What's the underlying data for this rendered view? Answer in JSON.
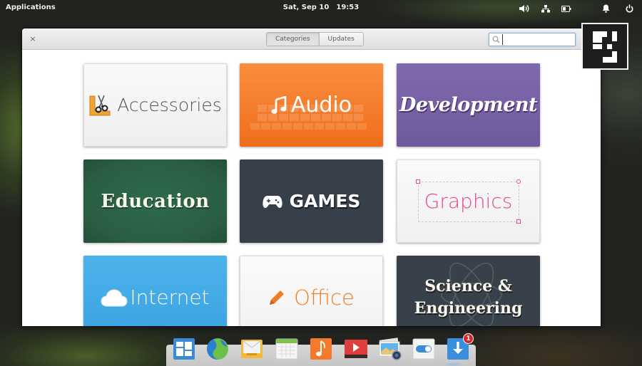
{
  "panel": {
    "applications_label": "Applications",
    "date": "Sat, Sep 10",
    "time": "19:53",
    "tray_icons": [
      "volume-icon",
      "network-icon",
      "battery-icon",
      "notifications-icon",
      "power-icon"
    ]
  },
  "window": {
    "close_glyph": "×",
    "view_switcher": [
      {
        "label": "Categories",
        "active": true
      },
      {
        "label": "Updates",
        "active": false
      }
    ],
    "search": {
      "value": "",
      "placeholder": ""
    },
    "maximize_icon": "maximize-icon"
  },
  "categories": [
    {
      "label": "Accessories",
      "icon": "accessories-icon",
      "color": "#555555"
    },
    {
      "label": "Audio",
      "icon": "music-note-icon",
      "color": "#f27a2a"
    },
    {
      "label": "Development",
      "icon": "",
      "color": "#7763a4"
    },
    {
      "label": "Education",
      "icon": "",
      "color": "#2a5e43"
    },
    {
      "label": "GAMES",
      "icon": "gamepad-icon",
      "color": "#37404a"
    },
    {
      "label": "Graphics",
      "icon": "",
      "color": "#e6478e"
    },
    {
      "label": "Internet",
      "icon": "cloud-icon",
      "color": "#3ea8e5"
    },
    {
      "label": "Office",
      "icon": "pencil-icon",
      "color": "#f07d21"
    },
    {
      "label": "Science &",
      "label2": "Engineering",
      "icon": "atom-icon",
      "color": "#38414a"
    }
  ],
  "dock": {
    "items": [
      {
        "name": "multitasking-view",
        "icon": "multitasking-icon"
      },
      {
        "name": "web-browser",
        "icon": "globe-icon"
      },
      {
        "name": "mail",
        "icon": "mail-icon"
      },
      {
        "name": "calendar",
        "icon": "calendar-icon"
      },
      {
        "name": "music",
        "icon": "music-icon"
      },
      {
        "name": "videos",
        "icon": "video-play-icon"
      },
      {
        "name": "photos",
        "icon": "photos-icon"
      },
      {
        "name": "system-settings",
        "icon": "toggle-switch-icon"
      },
      {
        "name": "app-center",
        "icon": "download-arrow-icon",
        "badge": "1"
      }
    ]
  }
}
